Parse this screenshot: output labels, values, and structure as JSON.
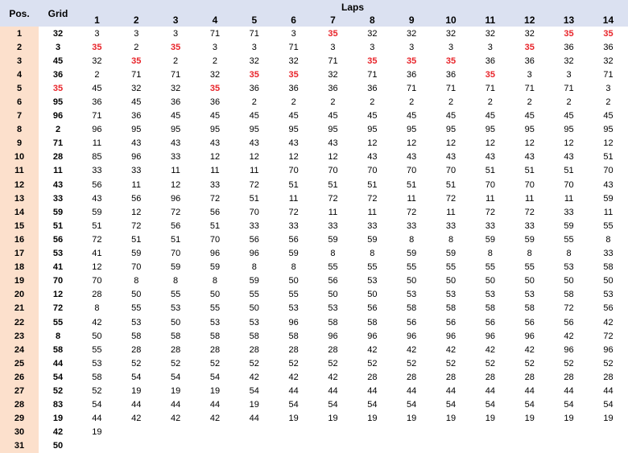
{
  "headers": {
    "pos": "Pos.",
    "grid": "Grid",
    "laps": "Laps"
  },
  "lap_numbers": [
    "1",
    "2",
    "3",
    "4",
    "5",
    "6",
    "7",
    "8",
    "9",
    "10",
    "11",
    "12",
    "13",
    "14"
  ],
  "highlight_value": "35",
  "colors": {
    "header_bg": "#dbe1f1",
    "pos_bg": "#fce0cc",
    "highlight": "#e8242a"
  },
  "rows": [
    {
      "pos": "1",
      "grid": "32",
      "laps": [
        "3",
        "3",
        "3",
        "71",
        "71",
        "3",
        "35",
        "32",
        "32",
        "32",
        "32",
        "32",
        "35",
        "35"
      ]
    },
    {
      "pos": "2",
      "grid": "3",
      "laps": [
        "35",
        "2",
        "35",
        "3",
        "3",
        "71",
        "3",
        "3",
        "3",
        "3",
        "3",
        "35",
        "36",
        "36"
      ]
    },
    {
      "pos": "3",
      "grid": "45",
      "laps": [
        "32",
        "35",
        "2",
        "2",
        "32",
        "32",
        "71",
        "35",
        "35",
        "35",
        "36",
        "36",
        "32",
        "32"
      ]
    },
    {
      "pos": "4",
      "grid": "36",
      "laps": [
        "2",
        "71",
        "71",
        "32",
        "35",
        "35",
        "32",
        "71",
        "36",
        "36",
        "35",
        "3",
        "3",
        "71"
      ]
    },
    {
      "pos": "5",
      "grid": "35",
      "laps": [
        "45",
        "32",
        "32",
        "35",
        "36",
        "36",
        "36",
        "36",
        "71",
        "71",
        "71",
        "71",
        "71",
        "3"
      ]
    },
    {
      "pos": "6",
      "grid": "95",
      "laps": [
        "36",
        "45",
        "36",
        "36",
        "2",
        "2",
        "2",
        "2",
        "2",
        "2",
        "2",
        "2",
        "2",
        "2"
      ]
    },
    {
      "pos": "7",
      "grid": "96",
      "laps": [
        "71",
        "36",
        "45",
        "45",
        "45",
        "45",
        "45",
        "45",
        "45",
        "45",
        "45",
        "45",
        "45",
        "45"
      ]
    },
    {
      "pos": "8",
      "grid": "2",
      "laps": [
        "96",
        "95",
        "95",
        "95",
        "95",
        "95",
        "95",
        "95",
        "95",
        "95",
        "95",
        "95",
        "95",
        "95"
      ]
    },
    {
      "pos": "9",
      "grid": "71",
      "laps": [
        "11",
        "43",
        "43",
        "43",
        "43",
        "43",
        "43",
        "12",
        "12",
        "12",
        "12",
        "12",
        "12",
        "12"
      ]
    },
    {
      "pos": "10",
      "grid": "28",
      "laps": [
        "85",
        "96",
        "33",
        "12",
        "12",
        "12",
        "12",
        "43",
        "43",
        "43",
        "43",
        "43",
        "43",
        "51"
      ]
    },
    {
      "pos": "11",
      "grid": "11",
      "laps": [
        "33",
        "33",
        "11",
        "11",
        "11",
        "70",
        "70",
        "70",
        "70",
        "70",
        "51",
        "51",
        "51",
        "70"
      ]
    },
    {
      "pos": "12",
      "grid": "43",
      "laps": [
        "56",
        "11",
        "12",
        "33",
        "72",
        "51",
        "51",
        "51",
        "51",
        "51",
        "70",
        "70",
        "70",
        "43"
      ]
    },
    {
      "pos": "13",
      "grid": "33",
      "laps": [
        "43",
        "56",
        "96",
        "72",
        "51",
        "11",
        "72",
        "72",
        "11",
        "72",
        "11",
        "11",
        "11",
        "59"
      ]
    },
    {
      "pos": "14",
      "grid": "59",
      "laps": [
        "59",
        "12",
        "72",
        "56",
        "70",
        "72",
        "11",
        "11",
        "72",
        "11",
        "72",
        "72",
        "33",
        "11"
      ]
    },
    {
      "pos": "15",
      "grid": "51",
      "laps": [
        "51",
        "72",
        "56",
        "51",
        "33",
        "33",
        "33",
        "33",
        "33",
        "33",
        "33",
        "33",
        "59",
        "55"
      ]
    },
    {
      "pos": "16",
      "grid": "56",
      "laps": [
        "72",
        "51",
        "51",
        "70",
        "56",
        "56",
        "59",
        "59",
        "8",
        "8",
        "59",
        "59",
        "55",
        "8"
      ]
    },
    {
      "pos": "17",
      "grid": "53",
      "laps": [
        "41",
        "59",
        "70",
        "96",
        "96",
        "59",
        "8",
        "8",
        "59",
        "59",
        "8",
        "8",
        "8",
        "33"
      ]
    },
    {
      "pos": "18",
      "grid": "41",
      "laps": [
        "12",
        "70",
        "59",
        "59",
        "8",
        "8",
        "55",
        "55",
        "55",
        "55",
        "55",
        "55",
        "53",
        "58"
      ]
    },
    {
      "pos": "19",
      "grid": "70",
      "laps": [
        "70",
        "8",
        "8",
        "8",
        "59",
        "50",
        "56",
        "53",
        "50",
        "50",
        "50",
        "50",
        "50",
        "50"
      ]
    },
    {
      "pos": "20",
      "grid": "12",
      "laps": [
        "28",
        "50",
        "55",
        "50",
        "55",
        "55",
        "50",
        "50",
        "53",
        "53",
        "53",
        "53",
        "58",
        "53"
      ]
    },
    {
      "pos": "21",
      "grid": "72",
      "laps": [
        "8",
        "55",
        "53",
        "55",
        "50",
        "53",
        "53",
        "56",
        "58",
        "58",
        "58",
        "58",
        "72",
        "56"
      ]
    },
    {
      "pos": "22",
      "grid": "55",
      "laps": [
        "42",
        "53",
        "50",
        "53",
        "53",
        "96",
        "58",
        "58",
        "56",
        "56",
        "56",
        "56",
        "56",
        "42"
      ]
    },
    {
      "pos": "23",
      "grid": "8",
      "laps": [
        "50",
        "58",
        "58",
        "58",
        "58",
        "58",
        "96",
        "96",
        "96",
        "96",
        "96",
        "96",
        "42",
        "72"
      ]
    },
    {
      "pos": "24",
      "grid": "58",
      "laps": [
        "55",
        "28",
        "28",
        "28",
        "28",
        "28",
        "28",
        "42",
        "42",
        "42",
        "42",
        "42",
        "96",
        "96"
      ]
    },
    {
      "pos": "25",
      "grid": "44",
      "laps": [
        "53",
        "52",
        "52",
        "52",
        "52",
        "52",
        "52",
        "52",
        "52",
        "52",
        "52",
        "52",
        "52",
        "52"
      ]
    },
    {
      "pos": "26",
      "grid": "54",
      "laps": [
        "58",
        "54",
        "54",
        "54",
        "42",
        "42",
        "42",
        "28",
        "28",
        "28",
        "28",
        "28",
        "28",
        "28"
      ]
    },
    {
      "pos": "27",
      "grid": "52",
      "laps": [
        "52",
        "19",
        "19",
        "19",
        "54",
        "44",
        "44",
        "44",
        "44",
        "44",
        "44",
        "44",
        "44",
        "44"
      ]
    },
    {
      "pos": "28",
      "grid": "83",
      "laps": [
        "54",
        "44",
        "44",
        "44",
        "19",
        "54",
        "54",
        "54",
        "54",
        "54",
        "54",
        "54",
        "54",
        "54"
      ]
    },
    {
      "pos": "29",
      "grid": "19",
      "laps": [
        "44",
        "42",
        "42",
        "42",
        "44",
        "19",
        "19",
        "19",
        "19",
        "19",
        "19",
        "19",
        "19",
        "19"
      ]
    },
    {
      "pos": "30",
      "grid": "42",
      "laps": [
        "19",
        "",
        "",
        "",
        "",
        "",
        "",
        "",
        "",
        "",
        "",
        "",
        "",
        ""
      ]
    },
    {
      "pos": "31",
      "grid": "50",
      "laps": [
        "",
        "",
        "",
        "",
        "",
        "",
        "",
        "",
        "",
        "",
        "",
        "",
        "",
        ""
      ]
    }
  ]
}
